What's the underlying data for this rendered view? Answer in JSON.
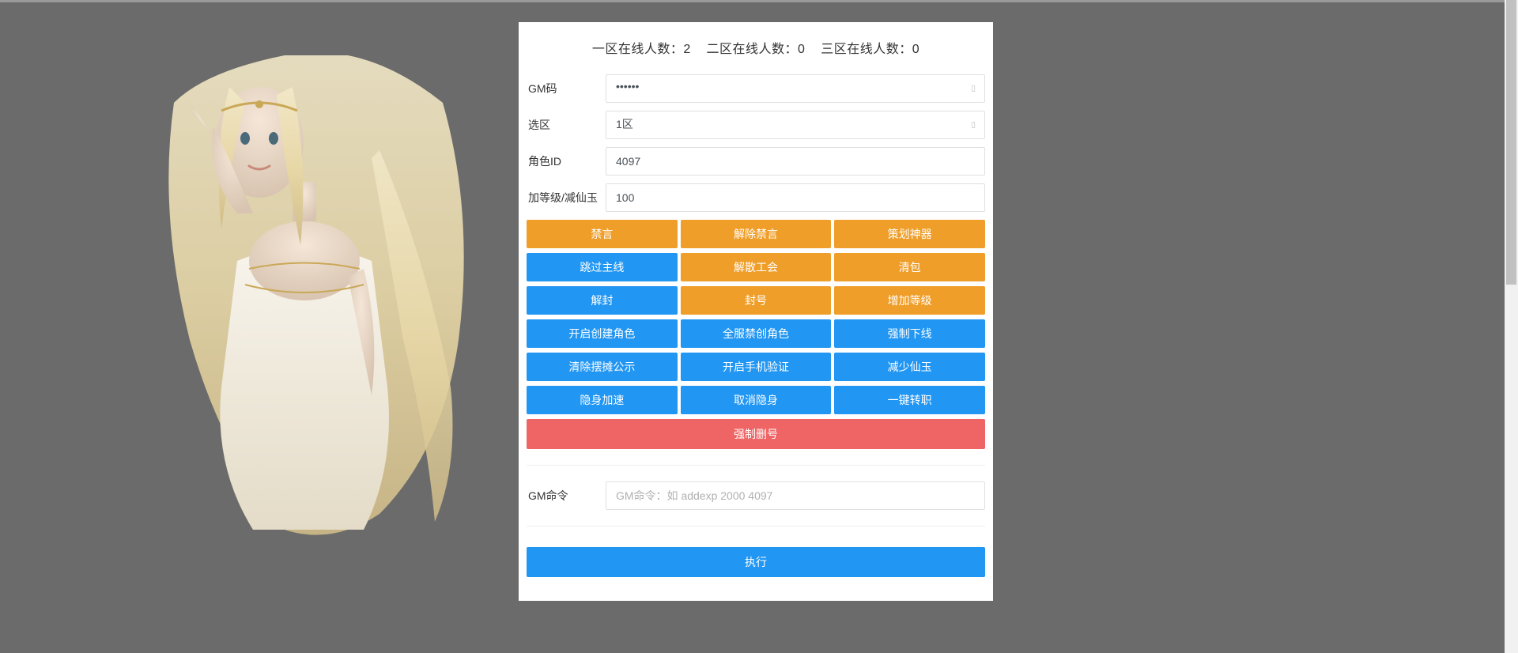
{
  "header": {
    "online_text": "一区在线人数：2    二区在线人数：0    三区在线人数：0"
  },
  "form": {
    "gm_code_label": "GM码",
    "gm_code_value": "••••••",
    "zone_label": "选区",
    "zone_value": "1区",
    "role_id_label": "角色ID",
    "role_id_value": "4097",
    "level_label": "加等级/减仙玉",
    "level_value": "100"
  },
  "button_rows": [
    [
      {
        "label": "禁言",
        "color": "orange"
      },
      {
        "label": "解除禁言",
        "color": "orange"
      },
      {
        "label": "策划神器",
        "color": "orange"
      }
    ],
    [
      {
        "label": "跳过主线",
        "color": "blue"
      },
      {
        "label": "解散工会",
        "color": "orange"
      },
      {
        "label": "清包",
        "color": "orange"
      }
    ],
    [
      {
        "label": "解封",
        "color": "blue"
      },
      {
        "label": "封号",
        "color": "orange"
      },
      {
        "label": "增加等级",
        "color": "orange"
      }
    ],
    [
      {
        "label": "开启创建角色",
        "color": "blue"
      },
      {
        "label": "全服禁创角色",
        "color": "blue"
      },
      {
        "label": "强制下线",
        "color": "blue"
      }
    ],
    [
      {
        "label": "清除摆摊公示",
        "color": "blue"
      },
      {
        "label": "开启手机验证",
        "color": "blue"
      },
      {
        "label": "减少仙玉",
        "color": "blue"
      }
    ],
    [
      {
        "label": "隐身加速",
        "color": "blue"
      },
      {
        "label": "取消隐身",
        "color": "blue"
      },
      {
        "label": "一键转职",
        "color": "blue"
      }
    ]
  ],
  "force_delete": "强制删号",
  "command": {
    "label": "GM命令",
    "placeholder": "GM命令：如 addexp 2000 4097"
  },
  "execute_label": "执行"
}
